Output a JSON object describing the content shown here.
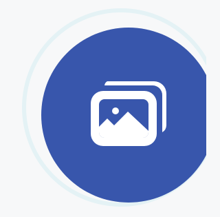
{
  "badge": {
    "icon": "image-gallery-icon",
    "background_color": "#3856ac",
    "halo_color": "#e4f2f5",
    "icon_color": "#ffffff"
  }
}
